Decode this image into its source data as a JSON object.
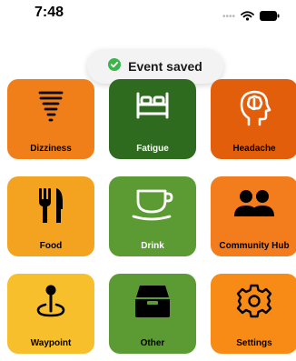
{
  "status_bar": {
    "time": "7:48",
    "icons": [
      "signal-dots-icon",
      "wifi-icon",
      "battery-icon"
    ]
  },
  "toast": {
    "message": "Event saved",
    "icon": "check-circle-icon",
    "icon_color": "#3bb54a"
  },
  "tiles": [
    {
      "label": "Dizziness",
      "icon": "tornado-icon",
      "color": "#f07f1a"
    },
    {
      "label": "Fatigue",
      "icon": "bed-icon",
      "color": "#2e6b1e"
    },
    {
      "label": "Headache",
      "icon": "brain-head-icon",
      "color": "#e35e0a"
    },
    {
      "label": "Food",
      "icon": "fork-knife-icon",
      "color": "#f3a31f"
    },
    {
      "label": "Drink",
      "icon": "cup-icon",
      "color": "#5c9b33"
    },
    {
      "label": "Community Hub",
      "icon": "people-icon",
      "color": "#f37d1c"
    },
    {
      "label": "Waypoint",
      "icon": "map-pin-icon",
      "color": "#f7bf2c"
    },
    {
      "label": "Other",
      "icon": "tray-icon",
      "color": "#5c9b33"
    },
    {
      "label": "Settings",
      "icon": "gear-icon",
      "color": "#f88b16"
    }
  ]
}
